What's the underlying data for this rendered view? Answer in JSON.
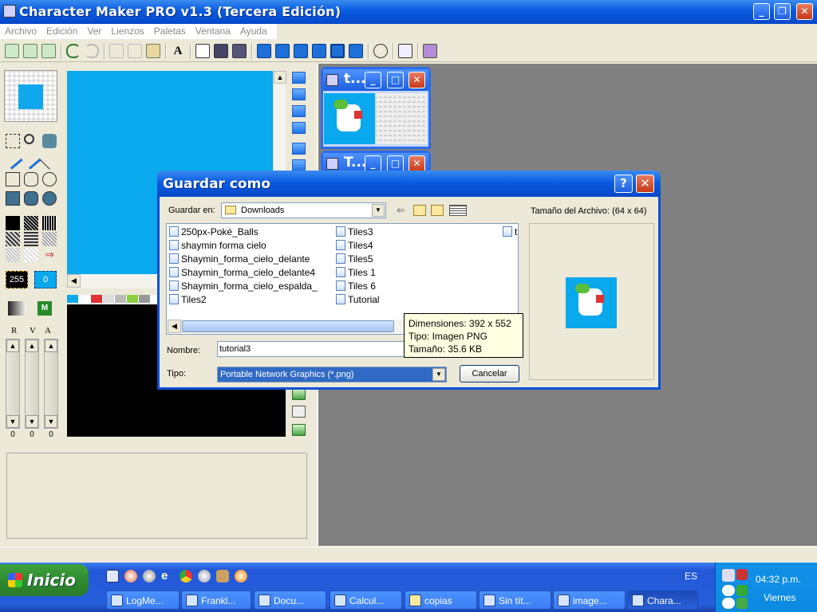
{
  "window": {
    "title": "Character Maker PRO v1.3 (Tercera Edición)",
    "controls": [
      "_",
      "❐",
      "✕"
    ]
  },
  "menu": [
    "Archivo",
    "Edición",
    "Ver",
    "Lienzos",
    "Paletas",
    "Ventana",
    "Ayuda"
  ],
  "left_panel": {
    "num_left": "255",
    "num_right": "0",
    "rva_labels": [
      "R",
      "V",
      "A"
    ],
    "slider_values": [
      "0",
      "0",
      "0"
    ]
  },
  "child_windows": [
    {
      "title": "t..."
    },
    {
      "title": "T..."
    }
  ],
  "dialog": {
    "title": "Guardar como",
    "help_btn": "?",
    "close_btn": "✕",
    "save_in_label": "Guardar en:",
    "save_in_value": "Downloads",
    "file_size_label": "Tamaño del Archivo: (64 x 64)",
    "files_col1": [
      "250px-Poké_Balls",
      "shaymin forma cielo",
      "Shaymin_forma_cielo_delante",
      "Shaymin_forma_cielo_delante4",
      "Shaymin_forma_cielo_espalda_",
      "Tiles2"
    ],
    "files_col2": [
      "Tiles3",
      "Tiles4",
      "Tiles5",
      "Tiles 1",
      "Tiles 6",
      "Tutorial"
    ],
    "files_col3": [
      "t"
    ],
    "name_label": "Nombre:",
    "name_value": "tutorial3",
    "type_label": "Tipo:",
    "type_value": "Portable Network Graphics (*.png)",
    "cancel_label": "Cancelar",
    "tooltip": {
      "dimensions": "Dimensiones: 392 x 552",
      "type": "Tipo: Imagen PNG",
      "size": "Tamaño: 35.6 KB"
    }
  },
  "taskbar": {
    "start_label": "Inicio",
    "language": "ES",
    "clock_time": "04:32 p.m.",
    "clock_day": "Viernes",
    "tasks": [
      "LogMe...",
      "Frankl...",
      "Docu...",
      "Calcul...",
      "copias",
      "Sin tít...",
      "image...",
      "Chara..."
    ],
    "active_task_index": 7
  },
  "colors": {
    "canvas_blue": "#0aa8ec",
    "xp_blue": "#0a5be0",
    "desktop_gray": "#808080"
  }
}
